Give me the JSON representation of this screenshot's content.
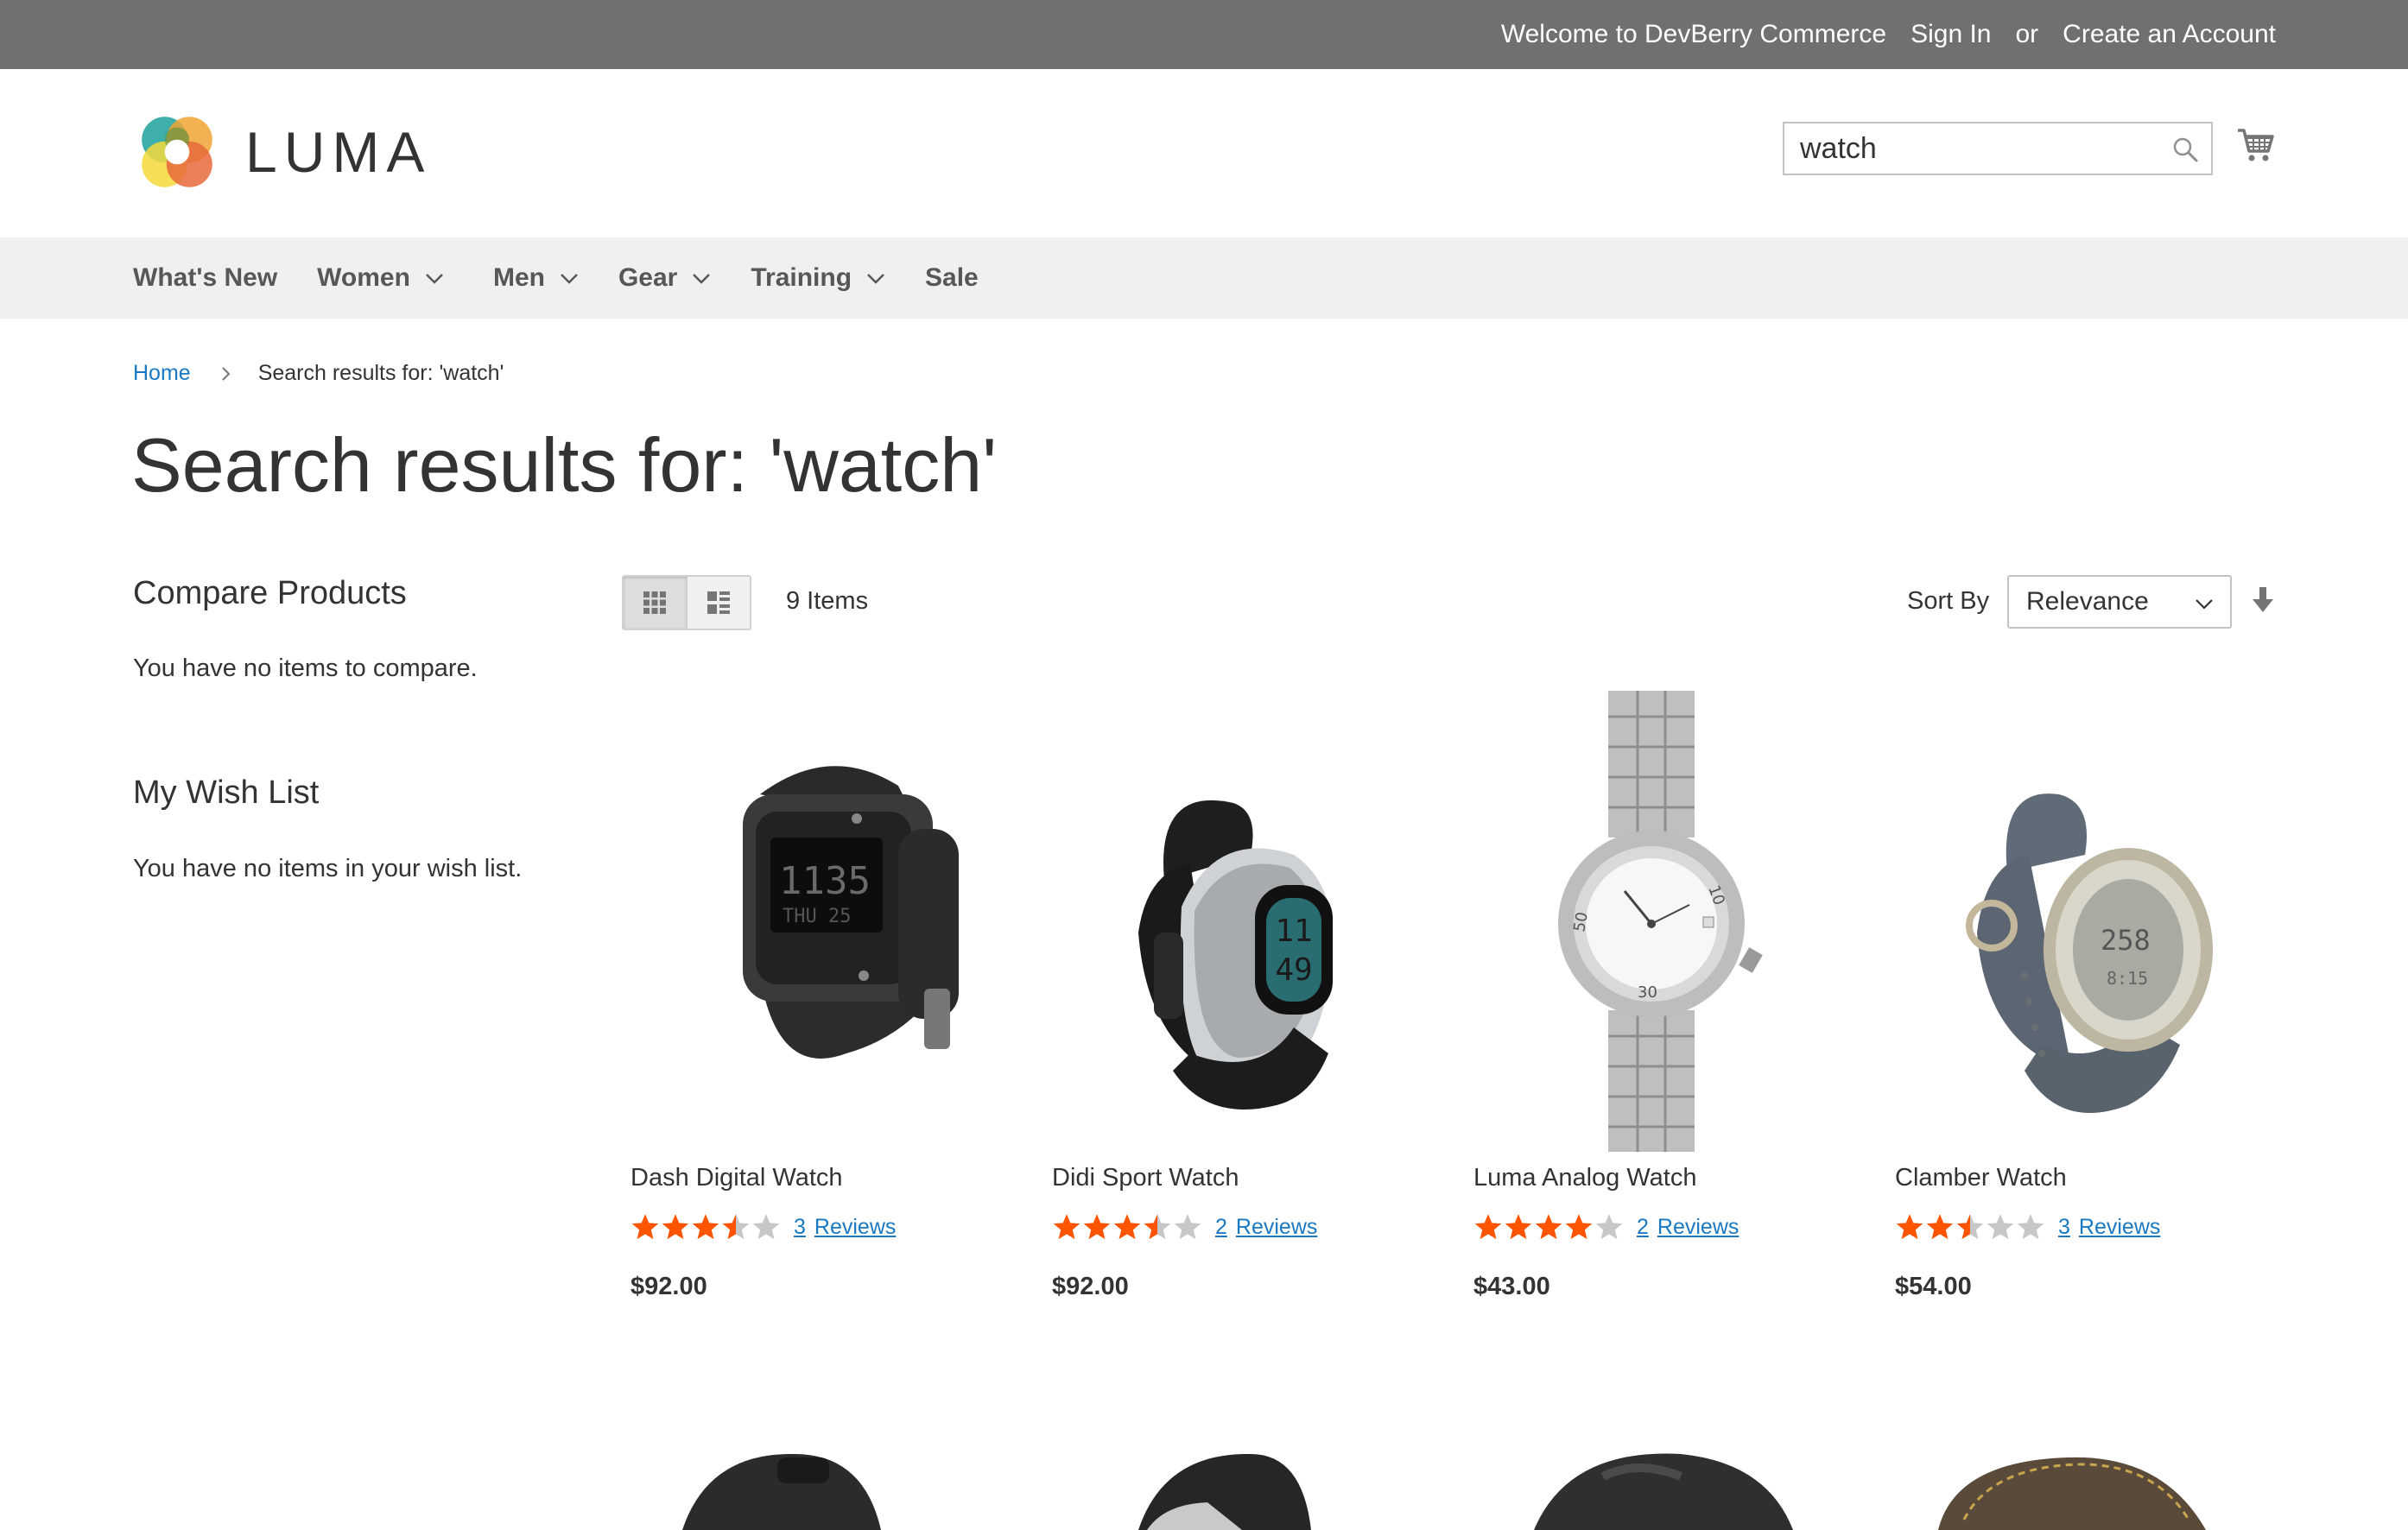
{
  "topbar": {
    "welcome": "Welcome to DevBerry Commerce",
    "sign_in": "Sign In",
    "or": "or",
    "create_account": "Create an Account"
  },
  "logo": {
    "text": "LUMA"
  },
  "search": {
    "value": "watch"
  },
  "nav": {
    "items": [
      {
        "label": "What's New",
        "dropdown": false
      },
      {
        "label": "Women",
        "dropdown": true
      },
      {
        "label": "Men",
        "dropdown": true
      },
      {
        "label": "Gear",
        "dropdown": true
      },
      {
        "label": "Training",
        "dropdown": true
      },
      {
        "label": "Sale",
        "dropdown": false
      }
    ]
  },
  "breadcrumb": {
    "home": "Home",
    "current": "Search results for: 'watch'"
  },
  "page": {
    "title": "Search results for: 'watch'"
  },
  "sidebar": {
    "compare_title": "Compare Products",
    "compare_text": "You have no items to compare.",
    "wishlist_title": "My Wish List",
    "wishlist_text": "You have no items in your wish list."
  },
  "toolbar": {
    "item_count": "9 Items",
    "sort_label": "Sort By",
    "sort_value": "Relevance",
    "active_view": "grid"
  },
  "colors": {
    "topbar": "#6e716e",
    "star": "#ff5501",
    "star_empty": "#c7c7c7",
    "link": "#1979c3",
    "nav_bg": "#f0f0f0"
  },
  "products": [
    {
      "name": "Dash Digital Watch",
      "rating": 3.5,
      "reviews_count": "3",
      "reviews_label": "Reviews",
      "price": "$92.00",
      "image": "dash-digital-watch-image"
    },
    {
      "name": "Didi Sport Watch",
      "rating": 3.5,
      "reviews_count": "2",
      "reviews_label": "Reviews",
      "price": "$92.00",
      "image": "didi-sport-watch-image"
    },
    {
      "name": "Luma Analog Watch",
      "rating": 4,
      "reviews_count": "2",
      "reviews_label": "Reviews",
      "price": "$43.00",
      "image": "luma-analog-watch-image"
    },
    {
      "name": "Clamber Watch",
      "rating": 2.5,
      "reviews_count": "3",
      "reviews_label": "Reviews",
      "price": "$54.00",
      "image": "clamber-watch-image"
    }
  ]
}
